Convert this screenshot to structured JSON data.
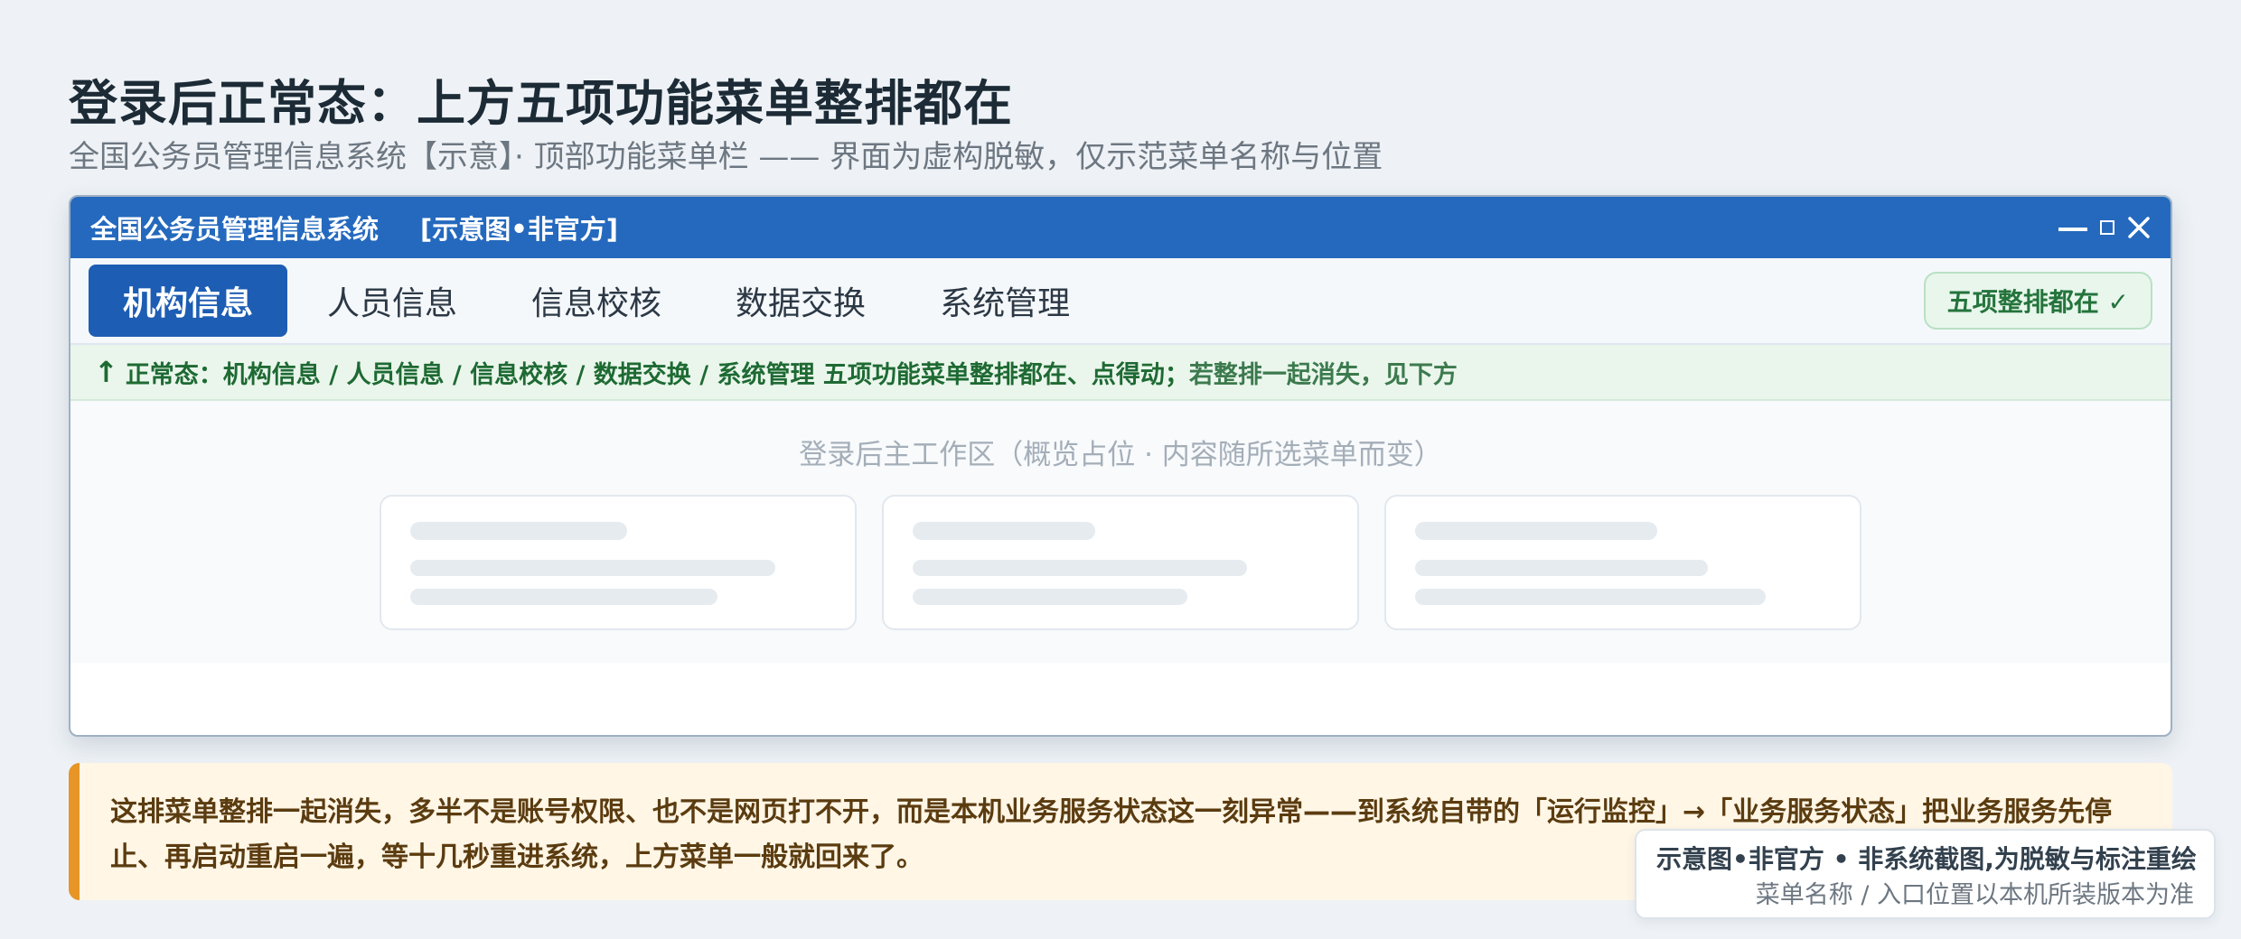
{
  "header": {
    "title": "登录后正常态：上方五项功能菜单整排都在",
    "subtitle": "全国公务员管理信息系统【示意】· 顶部功能菜单栏 —— 界面为虚构脱敏，仅示范菜单名称与位置"
  },
  "window": {
    "app_name": "全国公务员管理信息系统",
    "app_tag": "[示意图•非官方]",
    "controls": [
      "minimize-icon",
      "maximize-icon",
      "close-icon"
    ]
  },
  "menu": {
    "items": [
      {
        "label": "机构信息",
        "active": true
      },
      {
        "label": "人员信息",
        "active": false
      },
      {
        "label": "信息校核",
        "active": false
      },
      {
        "label": "数据交换",
        "active": false
      },
      {
        "label": "系统管理",
        "active": false
      }
    ],
    "badge": "五项整排都在 ✓"
  },
  "notice": {
    "arrow": "↑",
    "main": "正常态：机构信息 / 人员信息 / 信息校核 / 数据交换 / 系统管理 五项功能菜单整排都在、点得动；",
    "tail": "若整排一起消失，见下方"
  },
  "workspace": {
    "placeholder": "登录后主工作区（概览占位 · 内容随所选菜单而变）"
  },
  "warning": {
    "text": "这排菜单整排一起消失，多半不是账号权限、也不是网页打不开，而是本机业务服务状态这一刻异常——到系统自带的「运行监控」→「业务服务状态」把业务服务先停止、再启动重启一遍，等十几秒重进系统，上方菜单一般就回来了。"
  },
  "disclaimer": {
    "line1": "示意图•非官方 • 非系统截图,为脱敏与标注重绘",
    "line2": "菜单名称 / 入口位置以本机所装版本为准"
  },
  "colors": {
    "titlebar": "#2469be",
    "active_menu": "#1d5db3",
    "badge_green": "#24743c",
    "warning_accent": "#e69526"
  }
}
